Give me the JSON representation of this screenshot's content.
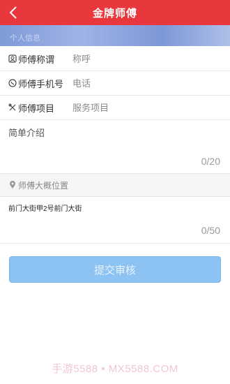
{
  "header": {
    "title": "金牌师傅"
  },
  "section": {
    "label": "个人信息"
  },
  "form": {
    "name": {
      "label": "师傅称谓",
      "placeholder": "称呼",
      "value": ""
    },
    "phone": {
      "label": "师傅手机号",
      "placeholder": "电话",
      "value": ""
    },
    "service": {
      "label": "师傅项目",
      "placeholder": "服务项目",
      "value": ""
    },
    "intro": {
      "placeholder": "简单介绍",
      "value": "",
      "counter": "0/20"
    },
    "location": {
      "label": "师傅大概位置"
    },
    "address": {
      "value": "前门大街甲2号前门大街",
      "counter": "0/50"
    },
    "submit_label": "提交审核"
  },
  "watermark": "手游5588 • MX5588.COM",
  "colors": {
    "header": "#e8383d",
    "submit": "#8cc3f3",
    "section": "#7f9bd8"
  },
  "icons": {
    "back": "chevron-left-icon",
    "name": "person-icon",
    "phone": "phone-icon",
    "service": "tools-icon",
    "location": "location-pin-icon"
  }
}
